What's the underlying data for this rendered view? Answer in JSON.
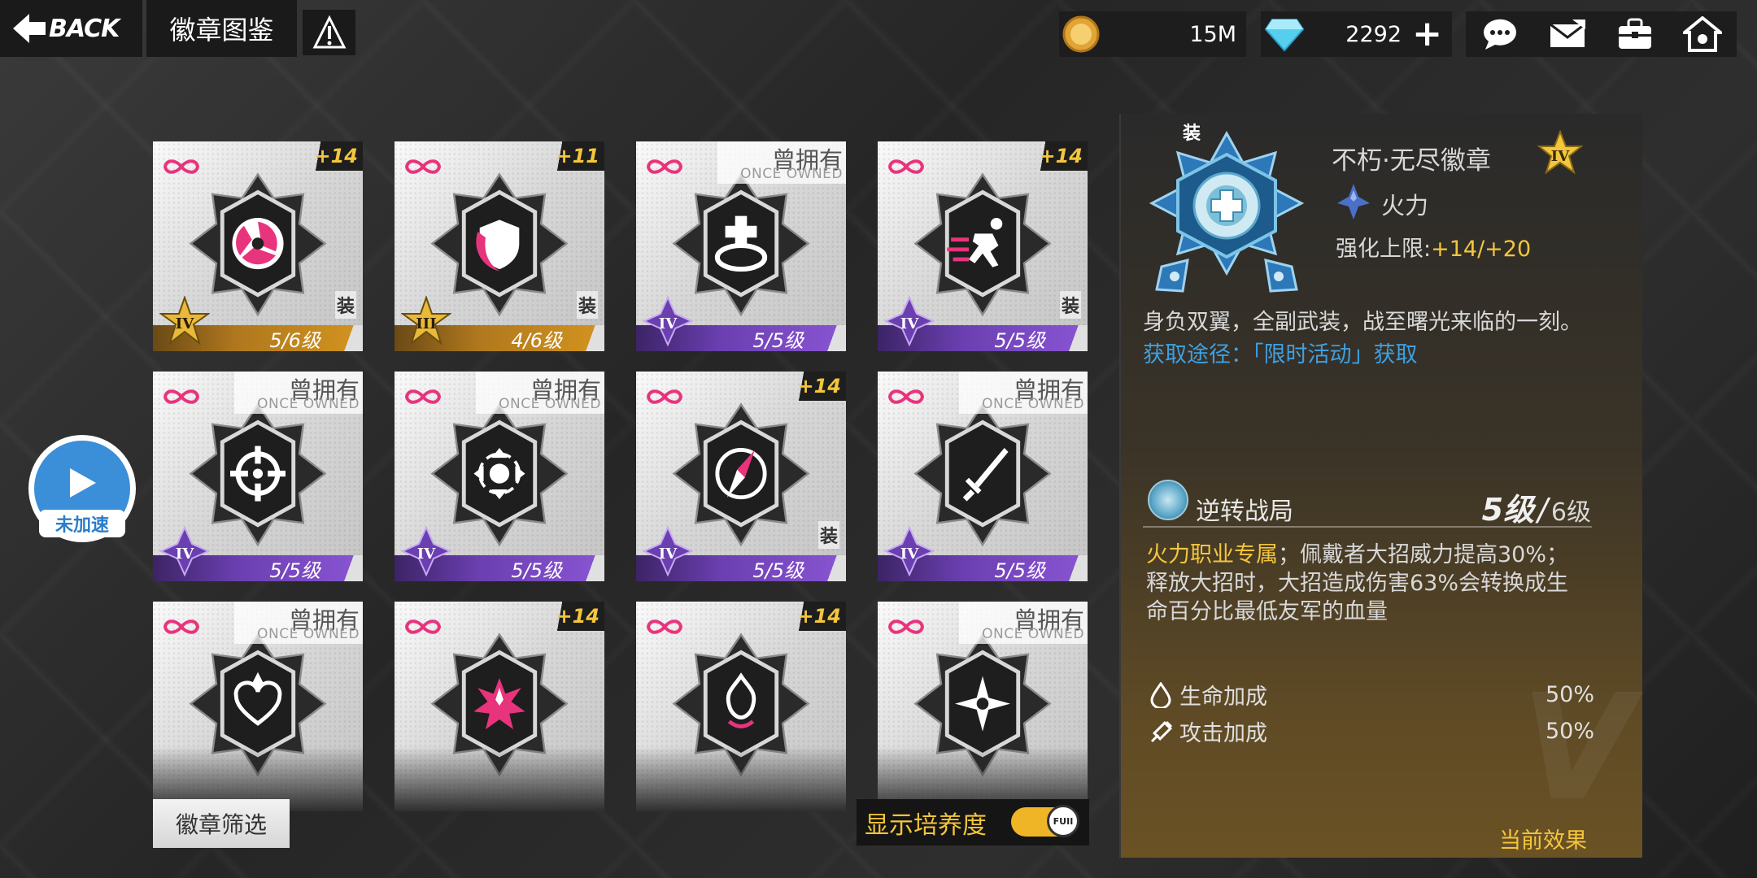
{
  "header": {
    "back_label": "BACK",
    "title": "徽章图鉴"
  },
  "resources": {
    "coins": "15M",
    "gems": "2292"
  },
  "colors": {
    "gold": "#f3c63b",
    "purple_rarity": "#7a48c4",
    "gold_rarity": "#d3941e",
    "link_blue": "#3fa0e0",
    "speed_blue": "#3b8ed8"
  },
  "speed_button": {
    "label": "未加速"
  },
  "badges": [
    {
      "plus": "+14",
      "owned_cn": "",
      "owned_en": "",
      "level": "5/6级",
      "rank": "IV",
      "rarity": "gold",
      "equipped": "装",
      "icon": "tri-swirl-icon"
    },
    {
      "plus": "+11",
      "owned_cn": "",
      "owned_en": "",
      "level": "4/6级",
      "rank": "III",
      "rarity": "gold",
      "equipped": "装",
      "icon": "shield-icon"
    },
    {
      "plus": "",
      "owned_cn": "曾拥有",
      "owned_en": "ONCE OWNED",
      "level": "5/5级",
      "rank": "IV",
      "rarity": "purple",
      "equipped": "",
      "icon": "cross-bowl-icon"
    },
    {
      "plus": "+14",
      "owned_cn": "",
      "owned_en": "",
      "level": "5/5级",
      "rank": "IV",
      "rarity": "purple",
      "equipped": "装",
      "icon": "runner-icon"
    },
    {
      "plus": "",
      "owned_cn": "曾拥有",
      "owned_en": "ONCE OWNED",
      "level": "5/5级",
      "rank": "IV",
      "rarity": "purple",
      "equipped": "",
      "icon": "crosshair-icon"
    },
    {
      "plus": "",
      "owned_cn": "曾拥有",
      "owned_en": "ONCE OWNED",
      "level": "5/5级",
      "rank": "IV",
      "rarity": "purple",
      "equipped": "",
      "icon": "cycle-arrows-icon"
    },
    {
      "plus": "+14",
      "owned_cn": "",
      "owned_en": "",
      "level": "5/5级",
      "rank": "IV",
      "rarity": "purple",
      "equipped": "装",
      "icon": "compass-icon"
    },
    {
      "plus": "",
      "owned_cn": "曾拥有",
      "owned_en": "ONCE OWNED",
      "level": "5/5级",
      "rank": "IV",
      "rarity": "purple",
      "equipped": "",
      "icon": "sword-icon"
    },
    {
      "plus": "",
      "owned_cn": "曾拥有",
      "owned_en": "ONCE OWNED",
      "level": "",
      "rank": "",
      "rarity": "",
      "equipped": "",
      "icon": "heart-icon"
    },
    {
      "plus": "+14",
      "owned_cn": "",
      "owned_en": "",
      "level": "",
      "rank": "",
      "rarity": "",
      "equipped": "",
      "icon": "burst-icon"
    },
    {
      "plus": "+14",
      "owned_cn": "",
      "owned_en": "",
      "level": "",
      "rank": "",
      "rarity": "",
      "equipped": "",
      "icon": "flame-icon"
    },
    {
      "plus": "",
      "owned_cn": "曾拥有",
      "owned_en": "ONCE OWNED",
      "level": "",
      "rank": "",
      "rarity": "",
      "equipped": "",
      "icon": "shuriken-icon"
    }
  ],
  "filter_button": "徽章筛选",
  "toggle": {
    "label": "显示培养度",
    "knob_text": "FUII",
    "on": true
  },
  "detail": {
    "equip_tag": "装",
    "name": "不朽·无尽徽章",
    "rank": "IV",
    "class": "火力",
    "limit_label": "强化上限:",
    "limit_value": "+14/+20",
    "description": "身负双翼，全副武装，战至曙光来临的一刻。",
    "source_label": "获取途径：",
    "source_value": "「限时活动」获取",
    "skill": {
      "name": "逆转战局",
      "level_current": "5级",
      "level_max": "6级",
      "desc_highlight": "火力职业专属",
      "desc_line1": "；佩戴者大招威力提高30%；",
      "desc_line2": "释放大招时，大招造成伤害63%会转换成生",
      "desc_line3": "命百分比最低友军的血量"
    },
    "stats": [
      {
        "label": "生命加成",
        "value": "50%",
        "icon": "water-drop-icon"
      },
      {
        "label": "攻击加成",
        "value": "50%",
        "icon": "syringe-icon"
      }
    ],
    "current_effect": "当前效果"
  }
}
